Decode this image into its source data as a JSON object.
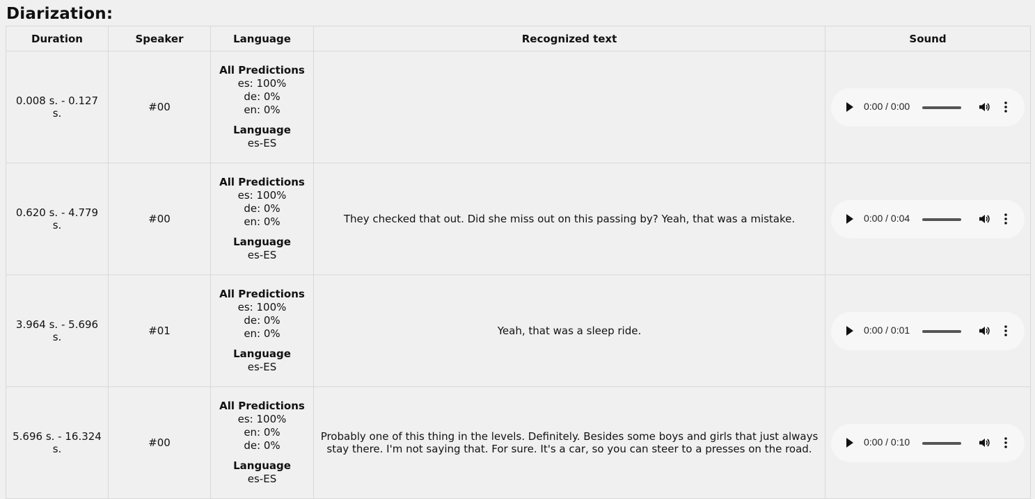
{
  "title": "Diarization:",
  "columns": [
    "Duration",
    "Speaker",
    "Language",
    "Recognized text",
    "Sound"
  ],
  "labels": {
    "all_predictions": "All Predictions",
    "language": "Language"
  },
  "rows": [
    {
      "duration": "0.008 s. - 0.127 s.",
      "speaker": "#00",
      "predictions": [
        "es: 100%",
        "de: 0%",
        "en: 0%"
      ],
      "language": "es-ES",
      "text": "",
      "time": "0:00 / 0:00"
    },
    {
      "duration": "0.620 s. - 4.779 s.",
      "speaker": "#00",
      "predictions": [
        "es: 100%",
        "de: 0%",
        "en: 0%"
      ],
      "language": "es-ES",
      "text": "They checked that out. Did she miss out on this passing by? Yeah, that was a mistake.",
      "time": "0:00 / 0:04"
    },
    {
      "duration": "3.964 s. - 5.696 s.",
      "speaker": "#01",
      "predictions": [
        "es: 100%",
        "de: 0%",
        "en: 0%"
      ],
      "language": "es-ES",
      "text": "Yeah, that was a sleep ride.",
      "time": "0:00 / 0:01"
    },
    {
      "duration": "5.696 s. - 16.324 s.",
      "speaker": "#00",
      "predictions": [
        "es: 100%",
        "en: 0%",
        "de: 0%"
      ],
      "language": "es-ES",
      "text": "Probably one of this thing in the levels. Definitely. Besides some boys and girls that just always stay there. I'm not saying that. For sure. It's a car, so you can steer to a presses on the road.",
      "time": "0:00 / 0:10"
    }
  ]
}
